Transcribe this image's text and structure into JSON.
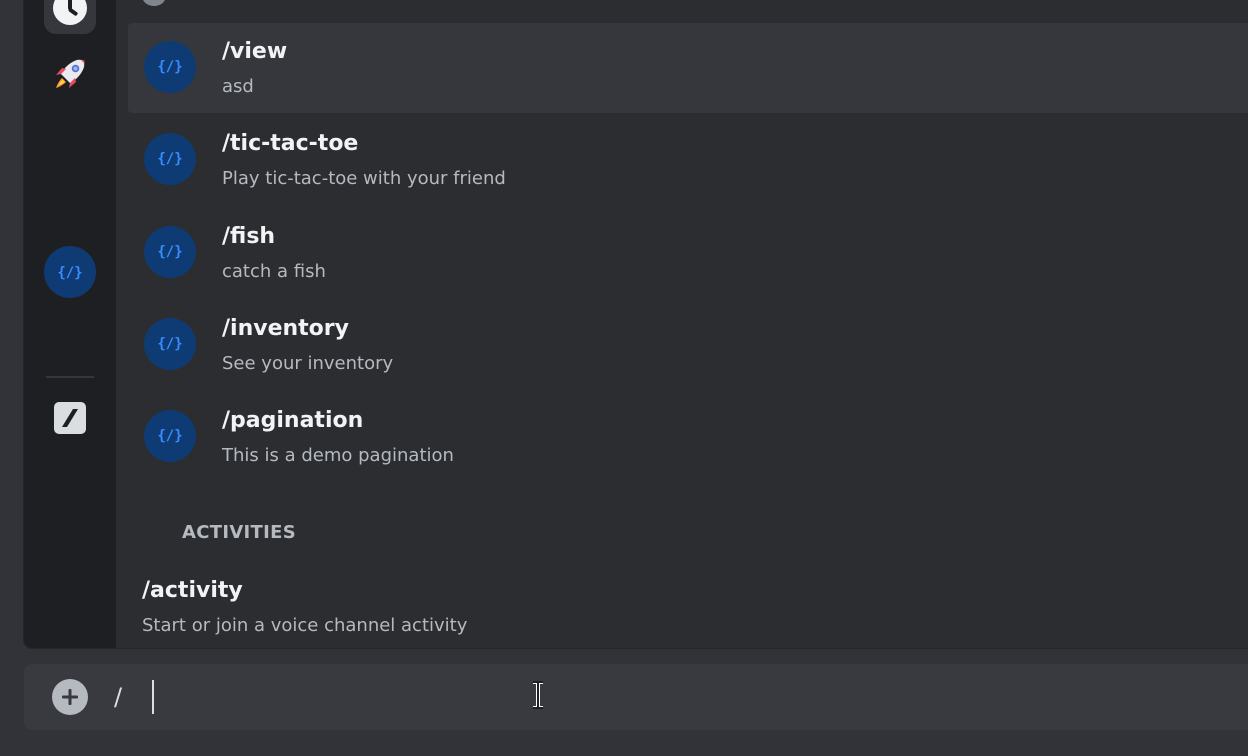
{
  "autocomplete": {
    "commands": [
      {
        "name": "/view",
        "description": "asd",
        "selected": true
      },
      {
        "name": "/tic-tac-toe",
        "description": "Play tic-tac-toe with your friend",
        "selected": false
      },
      {
        "name": "/fish",
        "description": "catch a fish",
        "selected": false
      },
      {
        "name": "/inventory",
        "description": "See your inventory",
        "selected": false
      },
      {
        "name": "/pagination",
        "description": "This is a demo pagination",
        "selected": false
      }
    ],
    "app_icon_glyph": "{/}",
    "activities_section": {
      "title": "ACTIVITIES",
      "item": {
        "name": "/activity",
        "description": "Start or join a voice channel activity"
      }
    }
  },
  "rail": {
    "icons": [
      "clock-icon",
      "rocket-icon",
      "app-command-icon",
      "slash-command-icon"
    ]
  },
  "composer": {
    "value": "/",
    "add_icon": "plus-circle-icon"
  },
  "colors": {
    "background": "#313338",
    "panel": "#2b2d31",
    "rail": "#1e1f22",
    "selected_row": "#35373c",
    "app_icon_bg": "#0e3b73",
    "app_icon_fg": "#3a8cff",
    "text_primary": "#f2f3f5",
    "text_secondary": "#b5bac1"
  }
}
